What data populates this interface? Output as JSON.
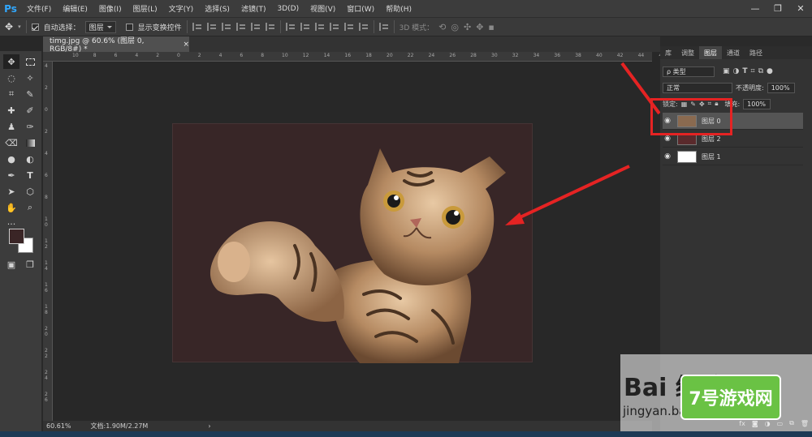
{
  "app": {
    "logo": "Ps"
  },
  "menu": [
    "文件(F)",
    "编辑(E)",
    "图像(I)",
    "图层(L)",
    "文字(Y)",
    "选择(S)",
    "滤镜(T)",
    "3D(D)",
    "视图(V)",
    "窗口(W)",
    "帮助(H)"
  ],
  "window_controls": {
    "minimize": "—",
    "restore": "❐",
    "close": "✕"
  },
  "options": {
    "auto_select_label": "自动选择：",
    "auto_select_checked": true,
    "auto_select_value": "图层",
    "show_transform_label": "显示变换控件",
    "show_transform_checked": false,
    "mode_3d_label": "3D 模式："
  },
  "document": {
    "tab_title": "timg.jpg @ 60.6% (图层 0, RGB/8#) *",
    "tab_close": "×",
    "zoom": "60.61%",
    "doc_info": "文档:1.90M/2.27M",
    "status_arrow": "›",
    "background_color": "#382627"
  },
  "rulers": {
    "top": [
      "10",
      "8",
      "6",
      "4",
      "2",
      "0",
      "2",
      "4",
      "6",
      "8",
      "10",
      "12",
      "14",
      "16",
      "18",
      "20",
      "22",
      "24",
      "26",
      "28",
      "30",
      "32",
      "34",
      "36",
      "38",
      "40",
      "42",
      "44",
      "46"
    ],
    "left": [
      "4",
      "2",
      "0",
      "2",
      "4",
      "6",
      "8",
      "1 0",
      "1 2",
      "1 4",
      "1 6",
      "1 8",
      "2 0",
      "2 2",
      "2 4",
      "2 6"
    ]
  },
  "panels": {
    "tabs": [
      "库",
      "调整",
      "图层",
      "通道",
      "路径"
    ],
    "active_tab": "图层",
    "filter_kind": "ρ 类型",
    "blend_mode": "正常",
    "opacity_label": "不透明度:",
    "opacity_value": "100%",
    "lock_label": "锁定:",
    "fill_label": "填充:",
    "fill_value": "100%",
    "layers": [
      {
        "name": "图层 0",
        "selected": true,
        "thumb": "#8a6a50"
      },
      {
        "name": "图层 2",
        "selected": false,
        "thumb": "#5a2a2c"
      },
      {
        "name": "图层 1",
        "selected": false,
        "thumb": "#ffffff"
      }
    ],
    "footer_icons": [
      "link-icon",
      "fx-icon",
      "mask-icon",
      "adjustment-icon",
      "folder-icon",
      "new-layer-icon",
      "trash-icon"
    ],
    "fx_label": "fx"
  },
  "colors": {
    "accent_red": "#e52323",
    "ps_blue": "#31a8ff",
    "foreground": "#3a2526",
    "background": "#ffffff"
  },
  "watermark": {
    "baidu": "Bai 经验",
    "baidu_url": "jingyan.baidu.com",
    "site_logo": "7号游戏网"
  }
}
